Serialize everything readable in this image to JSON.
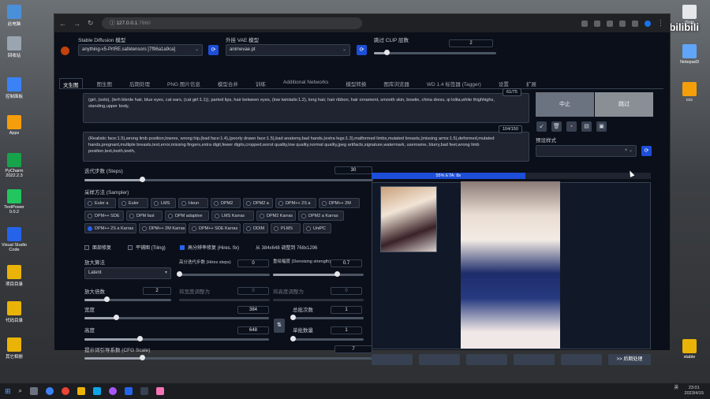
{
  "watermark": "秋葉aaaki bilibili",
  "desktop_icons": [
    {
      "label": "此电脑",
      "color": "#4a90d9"
    },
    {
      "label": "回收站",
      "color": "#9aa5b1"
    },
    {
      "label": "控制面板",
      "color": "#3b82f6"
    },
    {
      "label": "Apps",
      "color": "#f59e0b"
    },
    {
      "label": "PyCharm 2022.2.3",
      "color": "#16a34a"
    },
    {
      "label": "TextPower 0.0.2",
      "color": "#22c55e"
    },
    {
      "label": "Visual Studio Code",
      "color": "#2563eb"
    },
    {
      "label": "项目目录",
      "color": "#eab308"
    },
    {
      "label": "代码目录",
      "color": "#eab308"
    },
    {
      "label": "其它相册",
      "color": "#eab308"
    }
  ],
  "desktop_icons_right": [
    {
      "label": "iSnip",
      "color": "#e5e7eb"
    },
    {
      "label": "Notepad3",
      "color": "#60a5fa"
    },
    {
      "label": "ccc",
      "color": "#f59e0b"
    },
    {
      "label": "stable",
      "color": "#eab308"
    }
  ],
  "browser": {
    "url_host": "127.0.0.1",
    "url_port": ":7860",
    "title_bar": "192.254.23.16"
  },
  "header": {
    "model_label": "Stable Diffusion 模型",
    "model_value": "anything-v5-PrtRE.safetensors [7f96a1a9ca]",
    "vae_label": "外挂 VAE 模型",
    "vae_value": "animevae.pt",
    "clip_label": "跳过 CLIP 层数",
    "clip_value": "2",
    "clip_fraction": 0.1
  },
  "tabs": [
    "文生图",
    "图生图",
    "后期处理",
    "PNG 图片信息",
    "模型合并",
    "训练",
    "Additional Networks",
    "模型转换",
    "图库浏览器",
    "WD 1.4 标签器 (Tagger)",
    "设置",
    "扩展"
  ],
  "prompt": {
    "positive": "(girl, (solo), (lerh blenle hair, blue eyes, cat ears, (cat girl:1.1)), parted lips, hair between eyes, (low twintails:1.2), long hair, hair ribbon, hair ornament, smooth skin, bowtie, china dress, qi lolita,white thighhighs, standing,upper body,",
    "positive_counter": "61/75",
    "negative": "(Realistic face:1.5),wrong limb position,lowres, wrong hip,(bad face:1.4),(poorly drawn face:1.5),bad anatomy,bad hands,(extra legs:1.3),malformed limbs,mutated breasts,(missing arms:1.5),deformed,mutated hands,pregnant,multiple breasts,text,error,missing fingers,extra digit,fewer digits,cropped,worst quality,low quality,normal quality,jpeg artifacts,signature,watermark, username, blurry,bad feet,wrong limb position,text,tooth,teeth,",
    "negative_counter": "104/150"
  },
  "actions": {
    "interrupt": "中止",
    "skip": "跳过",
    "style_label": "预设样式",
    "style_value": ""
  },
  "steps": {
    "label": "迭代步数 (Steps)",
    "value": "30",
    "fraction": 0.2
  },
  "sampler": {
    "label": "采样方法 (Sampler)",
    "options": [
      "Euler a",
      "Euler",
      "LMS",
      "Heun",
      "DPM2",
      "DPM2 a",
      "DPM++ 2S a",
      "DPM++ 2M",
      "DPM++ SDE",
      "DPM fast",
      "DPM adaptive",
      "LMS Karras",
      "DPM2 Karras",
      "DPM2 a Karras",
      "DPM++ 2S a Karras",
      "DPM++ 2M Karras",
      "DPM++ SDE Karras",
      "DDIM",
      "PLMS",
      "UniPC"
    ],
    "selected": "DPM++ 2S a Karras"
  },
  "options": {
    "face_restore": "面部修复",
    "tiling": "平铺图 (Tiling)",
    "hires_fix": "高分辨率修复 (Hires. fix)",
    "hires_note": "从 384x648 调整到 768x1296"
  },
  "hires": {
    "upscaler_label": "放大算法",
    "upscaler_value": "Latent",
    "hires_steps_label": "高分迭代步数 (Hires steps)",
    "hires_steps_value": "0",
    "hires_steps_fraction": 0.0,
    "denoise_label": "重绘幅度 (Denoising strength)",
    "denoise_value": "0.7",
    "denoise_fraction": 0.7,
    "scale_label": "放大倍数",
    "scale_value": "2",
    "scale_fraction": 0.25,
    "resize_w_label": "将宽度调整为",
    "resize_w_value": "0",
    "resize_h_label": "将高度调整为",
    "resize_h_value": "0"
  },
  "size": {
    "width_label": "宽度",
    "width_value": "384",
    "width_fraction": 0.17,
    "height_label": "高度",
    "height_value": "648",
    "height_fraction": 0.3,
    "swap_icon": "swap-icon",
    "batch_count_label": "总批次数",
    "batch_count_value": "1",
    "batch_count_fraction": 0.0,
    "batch_size_label": "单批数量",
    "batch_size_value": "1",
    "batch_size_fraction": 0.0
  },
  "cfg": {
    "label": "提示词引导系数 (CFG Scale)",
    "value": "7",
    "fraction": 0.2
  },
  "progress": {
    "text": "55% ETA: 8s",
    "fraction": 0.55
  },
  "bottom_buttons": [
    "",
    "",
    "",
    "",
    "",
    ">> 后期处理"
  ],
  "taskbar": {
    "time": "23:01",
    "date": "2023/4/15",
    "lang": "英"
  }
}
